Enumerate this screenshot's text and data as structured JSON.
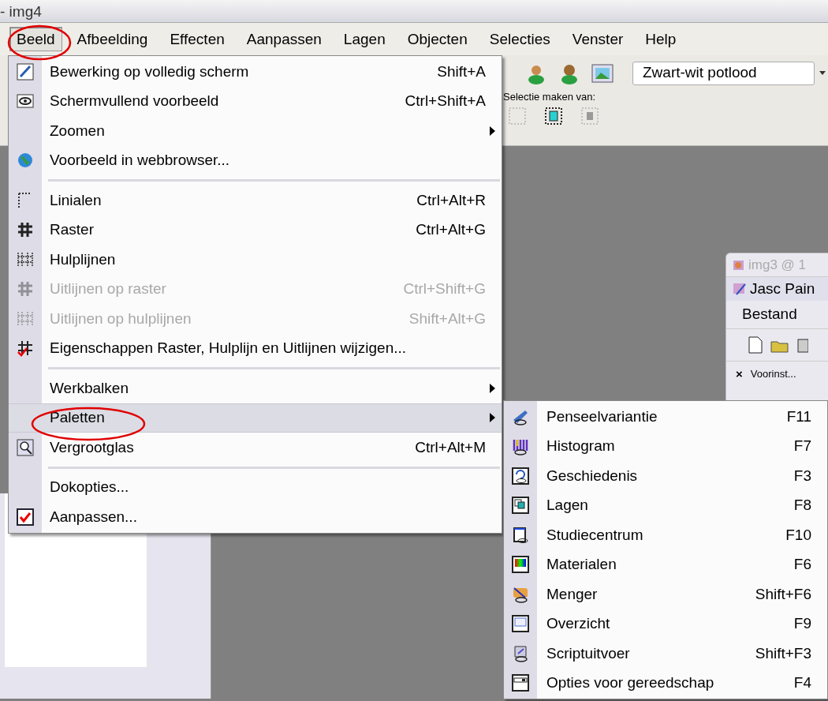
{
  "window": {
    "title": "- img4"
  },
  "menubar": [
    {
      "label": "Beeld",
      "selected": true
    },
    {
      "label": "Afbeelding",
      "selected": false
    },
    {
      "label": "Effecten",
      "selected": false
    },
    {
      "label": "Aanpassen",
      "selected": false
    },
    {
      "label": "Lagen",
      "selected": false
    },
    {
      "label": "Objecten",
      "selected": false
    },
    {
      "label": "Selecties",
      "selected": false
    },
    {
      "label": "Venster",
      "selected": false
    },
    {
      "label": "Help",
      "selected": false
    }
  ],
  "toolbar": {
    "preset": "Zwart-wit potlood",
    "selection_label": "Selectie maken van:"
  },
  "beeld_menu": {
    "items": [
      {
        "kind": "item",
        "label": "Bewerking op volledig scherm",
        "shortcut": "Shift+A",
        "disabled": false,
        "submenu": false,
        "selected": false
      },
      {
        "kind": "item",
        "label": "Schermvullend voorbeeld",
        "shortcut": "Ctrl+Shift+A",
        "disabled": false,
        "submenu": false,
        "selected": false
      },
      {
        "kind": "item",
        "label": "Zoomen",
        "disabled": false,
        "submenu": true,
        "selected": false
      },
      {
        "kind": "item",
        "label": "Voorbeeld in webbrowser...",
        "disabled": false,
        "submenu": false,
        "selected": false
      },
      {
        "kind": "separator"
      },
      {
        "kind": "item",
        "label": "Linialen",
        "shortcut": "Ctrl+Alt+R",
        "disabled": false,
        "submenu": false,
        "selected": false
      },
      {
        "kind": "item",
        "label": "Raster",
        "shortcut": "Ctrl+Alt+G",
        "disabled": false,
        "submenu": false,
        "selected": false
      },
      {
        "kind": "item",
        "label": "Hulplijnen",
        "disabled": false,
        "submenu": false,
        "selected": false
      },
      {
        "kind": "item",
        "label": "Uitlijnen op raster",
        "shortcut": "Ctrl+Shift+G",
        "disabled": true,
        "submenu": false,
        "selected": false
      },
      {
        "kind": "item",
        "label": "Uitlijnen op hulplijnen",
        "shortcut": "Shift+Alt+G",
        "disabled": true,
        "submenu": false,
        "selected": false
      },
      {
        "kind": "item",
        "label": "Eigenschappen Raster, Hulplijn en Uitlijnen wijzigen...",
        "disabled": false,
        "submenu": false,
        "selected": false
      },
      {
        "kind": "separator"
      },
      {
        "kind": "item",
        "label": "Werkbalken",
        "disabled": false,
        "submenu": true,
        "selected": false
      },
      {
        "kind": "item",
        "label": "Paletten",
        "disabled": false,
        "submenu": true,
        "selected": true
      },
      {
        "kind": "item",
        "label": "Vergrootglas",
        "shortcut": "Ctrl+Alt+M",
        "disabled": false,
        "submenu": false,
        "selected": false
      },
      {
        "kind": "separator"
      },
      {
        "kind": "item",
        "label": "Dokopties...",
        "disabled": false,
        "submenu": false,
        "selected": false
      },
      {
        "kind": "item",
        "label": "Aanpassen...",
        "disabled": false,
        "submenu": false,
        "selected": false
      }
    ]
  },
  "paletten_submenu": {
    "items": [
      {
        "label": "Penseelvariantie",
        "shortcut": "F11"
      },
      {
        "label": "Histogram",
        "shortcut": "F7"
      },
      {
        "label": "Geschiedenis",
        "shortcut": "F3"
      },
      {
        "label": "Lagen",
        "shortcut": "F8"
      },
      {
        "label": "Studiecentrum",
        "shortcut": "F10"
      },
      {
        "label": "Materialen",
        "shortcut": "F6"
      },
      {
        "label": "Menger",
        "shortcut": "Shift+F6"
      },
      {
        "label": "Overzicht",
        "shortcut": "F9"
      },
      {
        "label": "Scriptuitvoer",
        "shortcut": "Shift+F3"
      },
      {
        "label": "Opties voor gereedschap",
        "shortcut": "F4"
      }
    ]
  },
  "background_window": {
    "title": "img3 @ 1",
    "app_title": "Jasc Pain",
    "menu": [
      "Bestand"
    ],
    "close_glyph": "×",
    "tab": "Voorinst..."
  }
}
